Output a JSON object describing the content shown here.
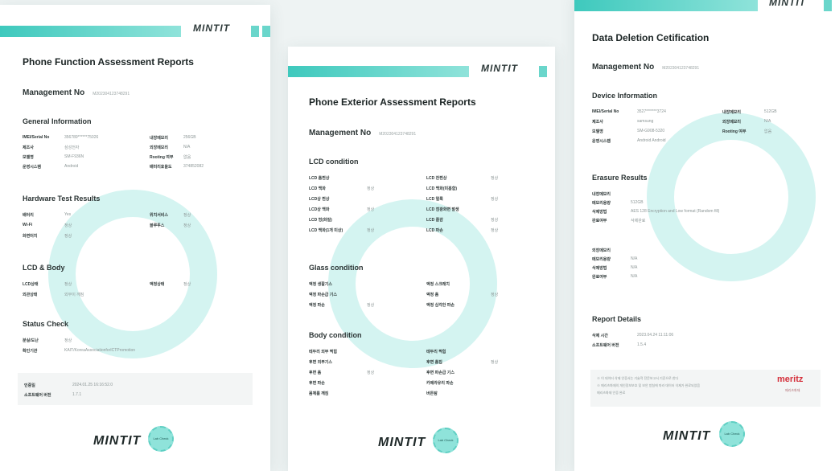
{
  "brand": {
    "logo": "MINTIT",
    "badge": "Lab Check",
    "meritz": "meritz",
    "meritz_sub": "메리츠화재"
  },
  "card1": {
    "title": "Phone Function Assessment Reports",
    "mgmt_label": "Management No",
    "mgmt_value": "M202304123748291",
    "s1": "General Information",
    "s1_rows": [
      [
        "IMEI/Serial No",
        "356789******75026",
        "내장메모리",
        "256GB"
      ],
      [
        "제조사",
        "삼성전자",
        "외장메모리",
        "N/A"
      ],
      [
        "모델명",
        "SM-F936N",
        "Rooting 여부",
        "없음"
      ],
      [
        "운영시스템",
        "Android",
        "배터리효율도",
        "374852082"
      ]
    ],
    "s2": "Hardware Test Results",
    "s2_rows": [
      [
        "배터리",
        "Yes",
        "위치서비스",
        "정상"
      ],
      [
        "Wi-Fi",
        "정상",
        "블루투스",
        "정상"
      ],
      [
        "화면터치",
        "정상",
        "",
        ""
      ]
    ],
    "s3": "LCD & Body",
    "s3_rows": [
      [
        "LCD상태",
        "정상",
        "액정상태",
        "정상"
      ],
      [
        "외관상태",
        "외부이 깨짐",
        "",
        ""
      ]
    ],
    "s4": "Status Check",
    "s4_rows": [
      [
        "분실/도난",
        "정상",
        "",
        ""
      ],
      [
        "확인기관",
        "KAIT/KoreaAssociationforICTPromotion",
        "",
        ""
      ]
    ],
    "footer_rows": [
      [
        "인증일",
        "2024.01.25 16:16:52.0"
      ],
      [
        "소프트웨어 버전",
        "1.7.1"
      ]
    ]
  },
  "card2": {
    "title": "Phone Exterior Assessment Reports",
    "mgmt_label": "Management No",
    "mgmt_value": "M202304123748291",
    "s1": "LCD condition",
    "s1_rows": [
      [
        "LCD 흠찐상",
        "",
        "LCD 잔찐상",
        "정상"
      ],
      [
        "LCD 백화",
        "정상",
        "LCD 백화(미흡함)",
        ""
      ],
      [
        "LCD상 찐상",
        "",
        "LCD 얼룩",
        "정상"
      ],
      [
        "LCD상 백화",
        "정상",
        "LCD 점광화면 발생",
        ""
      ],
      [
        "LCD 멍(화질)",
        "",
        "LCD 줄감",
        "정상"
      ],
      [
        "LCD 백화(1개 미상)",
        "정상",
        "LCD 파손",
        "정상"
      ]
    ],
    "s2": "Glass condition",
    "s2_rows": [
      [
        "액정 생활기스",
        "",
        "액정 스크래치",
        ""
      ],
      [
        "액정 파손급 기스",
        "",
        "액정 흠",
        "정상"
      ],
      [
        "액정 파손",
        "정상",
        "액정 심각한 파손",
        ""
      ]
    ],
    "s3": "Body condition",
    "s3_rows": [
      [
        "테두리 외부 찍힘",
        "",
        "테두리 찍힘",
        ""
      ],
      [
        "후면 외부기스",
        "",
        "후면 흠집",
        "정상"
      ],
      [
        "후면 흠",
        "정상",
        "후면 파손급 기스",
        ""
      ],
      [
        "후면 파손",
        "",
        "카메라유리 파손",
        ""
      ],
      [
        "몸체를 깨짐",
        "",
        "버튼탐",
        ""
      ]
    ]
  },
  "card3": {
    "title": "Data Deletion Cetification",
    "mgmt_label": "Management No",
    "mgmt_value": "M202304123748291",
    "s1": "Device Information",
    "s1_rows": [
      [
        "IMEI/Serial No",
        "3527*******3724",
        "내장메모리",
        "512GB"
      ],
      [
        "제조사",
        "samsung",
        "외장메모리",
        "N/A"
      ],
      [
        "모델명",
        "SM-G908-5320",
        "Rooting 여부",
        "없음"
      ],
      [
        "운영시스템",
        "Android Android",
        "",
        ""
      ]
    ],
    "s2": "Erasure Results",
    "s2_rows": [
      [
        "내장메모리",
        ""
      ],
      [
        "메모리용량",
        "512GB"
      ],
      [
        "삭제방법",
        "AES 128 Encryption and Low format (Random fill)"
      ],
      [
        "완료여부",
        "삭제완료"
      ]
    ],
    "s2b_rows": [
      [
        "외장메모리",
        ""
      ],
      [
        "메모리용량",
        "N/A"
      ],
      [
        "삭제방법",
        "N/A"
      ],
      [
        "완료여부",
        "N/A"
      ]
    ],
    "s3": "Report Details",
    "s3_rows": [
      [
        "삭제 시간",
        "2023.04.24 11:11:06"
      ],
      [
        "소프트웨어 버전",
        "1.5.4"
      ]
    ],
    "notes": [
      "※ 이 데이터 삭제 인증서는 기술적 전문보고서 기준으로 한다",
      "※ 메리츠화재의 개인정보보호 및 보안 방침에 따라 데이터 삭제가 완료되었음",
      "메리츠화재 인증 완료"
    ]
  }
}
